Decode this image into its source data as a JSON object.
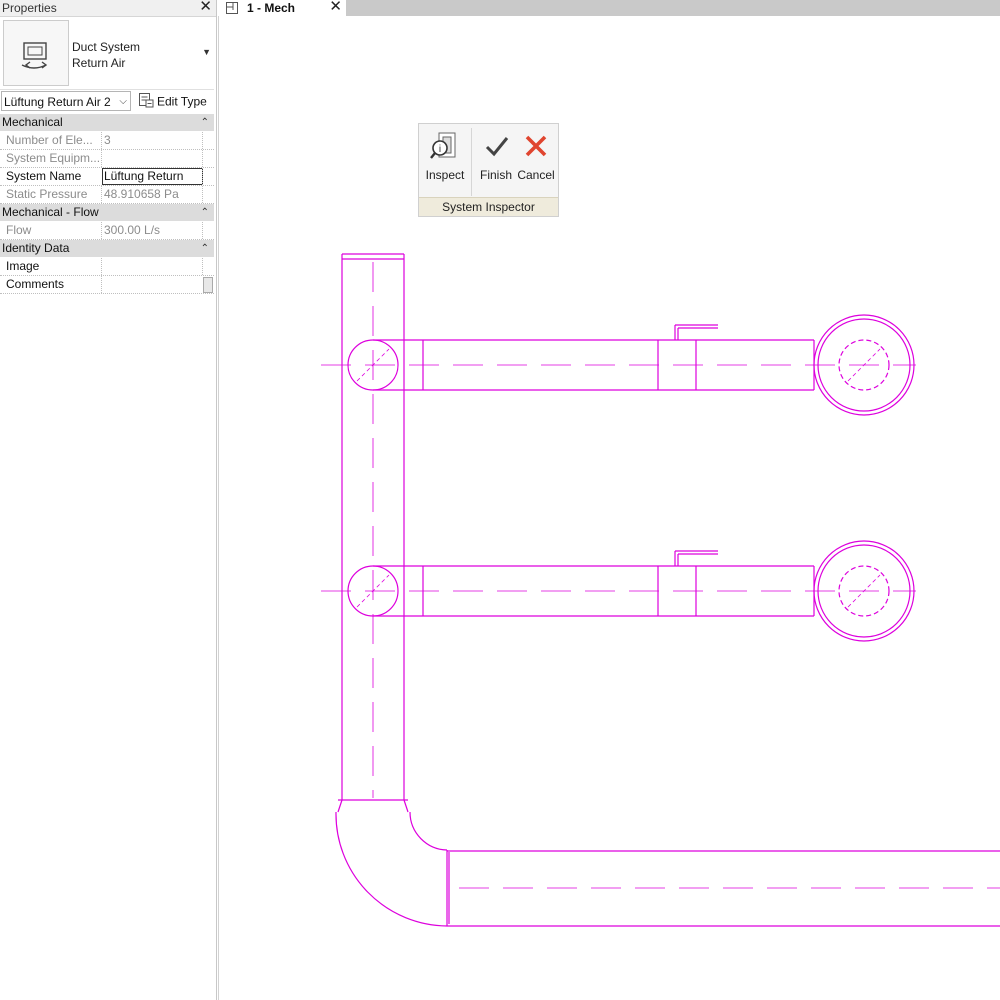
{
  "properties_panel": {
    "title": "Properties",
    "type_selector": {
      "family": "Duct System",
      "type": "Return Air",
      "icon": "duct-system-icon"
    },
    "instance_selector": {
      "value": "Lüftung Return Air 2"
    },
    "edit_type_label": "Edit Type",
    "categories": [
      {
        "name": "Mechanical",
        "rows": [
          {
            "name": "Number of Ele...",
            "value": "3",
            "editable": false
          },
          {
            "name": "System Equipm...",
            "value": "",
            "editable": false
          },
          {
            "name": "System Name",
            "value": "Lüftung Return",
            "editable": true,
            "editing": true
          },
          {
            "name": "Static Pressure",
            "value": "48.910658 Pa",
            "editable": false
          }
        ]
      },
      {
        "name": "Mechanical - Flow",
        "rows": [
          {
            "name": "Flow",
            "value": "300.00 L/s",
            "editable": false
          }
        ]
      },
      {
        "name": "Identity Data",
        "rows": [
          {
            "name": "Image",
            "value": "",
            "editable": true
          },
          {
            "name": "Comments",
            "value": "",
            "editable": true
          }
        ]
      }
    ]
  },
  "document_tab": {
    "label": "1 - Mech",
    "icon": "floor-plan-icon"
  },
  "system_inspector": {
    "title": "System Inspector",
    "buttons": [
      {
        "label": "Inspect",
        "icon": "inspect-icon"
      },
      {
        "label": "Finish",
        "icon": "checkmark-icon"
      },
      {
        "label": "Cancel",
        "icon": "red-x-icon"
      }
    ]
  },
  "colors": {
    "duct_line": "#dd00dd",
    "category_bg": "#dcdcdc",
    "inspector_title_bg": "#efebdc",
    "cancel_red": "#e0452f"
  }
}
